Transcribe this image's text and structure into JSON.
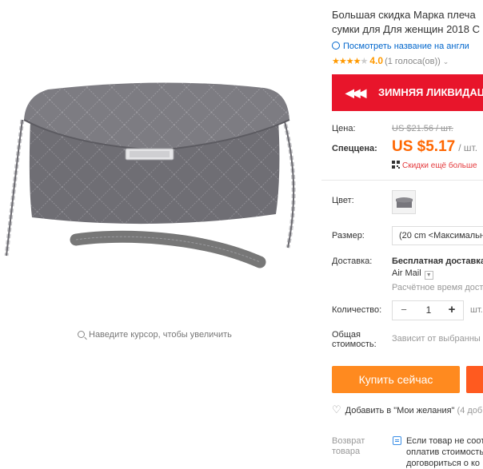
{
  "product": {
    "title_line1": "Большая скидка Марка плеча",
    "title_line2": "сумки для Для женщин 2018 C",
    "translate_link": "Посмотреть название на англи",
    "rating_value": "4.0",
    "rating_votes": "(1 голоса(ов))",
    "rating_stars": 4,
    "image_hint": "Наведите курсор, чтобы увеличить"
  },
  "promo": {
    "text": "ЗИМНЯЯ ЛИКВИДАЦ"
  },
  "price": {
    "label": "Цена:",
    "old": "US $21.56 / шт.",
    "sale_label": "Спеццена:",
    "sale_amount": "US $5.17",
    "sale_unit": "/ шт.",
    "coupon": "Скидки ещё больше"
  },
  "options": {
    "color_label": "Цвет:",
    "size_label": "Размер:",
    "size_value": "(20 cm <Максимальн"
  },
  "shipping": {
    "label": "Доставка:",
    "title": "Бесплатная доставка",
    "method": "Air Mail",
    "time": "Расчётное время доста"
  },
  "quantity": {
    "label": "Количество:",
    "value": "1",
    "unit": "шт."
  },
  "total": {
    "label_line1": "Общая",
    "label_line2": "стоимость:",
    "value": "Зависит от выбранны"
  },
  "actions": {
    "buy_now": "Купить сейчас",
    "wishlist": "Добавить в \"Мои желания\"",
    "wishlist_count": "(4 доб"
  },
  "returns": {
    "label_line1": "Возврат",
    "label_line2": "товара",
    "text_line1": "Если товар не соот",
    "text_line2": "оплатив стоимость",
    "text_line3": "договориться о ко"
  },
  "colors": {
    "accent": "#ff8a1f",
    "promo": "#e8152b",
    "sale": "#ff6600",
    "link": "#0066cc"
  }
}
